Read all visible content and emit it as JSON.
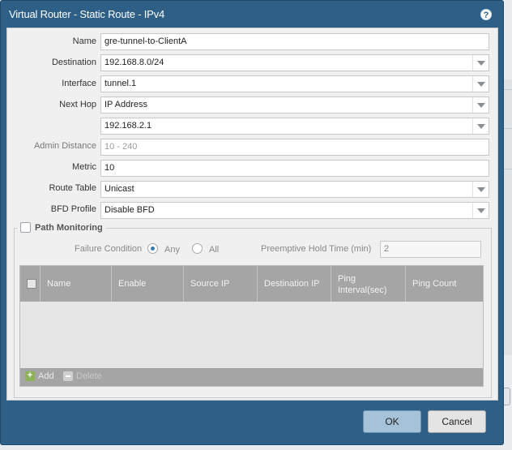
{
  "dialog": {
    "title": "Virtual Router - Static Route - IPv4",
    "help_icon": "?"
  },
  "form": {
    "name": {
      "label": "Name",
      "value": "gre-tunnel-to-ClientA"
    },
    "destination": {
      "label": "Destination",
      "value": "192.168.8.0/24"
    },
    "interface": {
      "label": "Interface",
      "value": "tunnel.1"
    },
    "next_hop": {
      "label": "Next Hop",
      "value": "IP Address",
      "address": "192.168.2.1"
    },
    "admin_distance": {
      "label": "Admin Distance",
      "placeholder": "10 - 240"
    },
    "metric": {
      "label": "Metric",
      "value": "10"
    },
    "route_table": {
      "label": "Route Table",
      "value": "Unicast"
    },
    "bfd_profile": {
      "label": "BFD Profile",
      "value": "Disable BFD"
    }
  },
  "path_monitoring": {
    "legend": "Path Monitoring",
    "checked": false,
    "failure_condition_label": "Failure Condition",
    "options": [
      "Any",
      "All"
    ],
    "selected": "Any",
    "preemptive_label": "Preemptive Hold Time (min)",
    "preemptive_value": "2",
    "table": {
      "columns": [
        "Name",
        "Enable",
        "Source IP",
        "Destination IP",
        "Ping Interval(sec)",
        "Ping Count"
      ],
      "rows": []
    },
    "add_label": "Add",
    "delete_label": "Delete"
  },
  "footer": {
    "ok_label": "OK",
    "cancel_label": "Cancel"
  },
  "colors": {
    "title_bar": "#2e5f86",
    "grid_header": "#a5a5a5",
    "ok_button": "#a5c2d9"
  }
}
